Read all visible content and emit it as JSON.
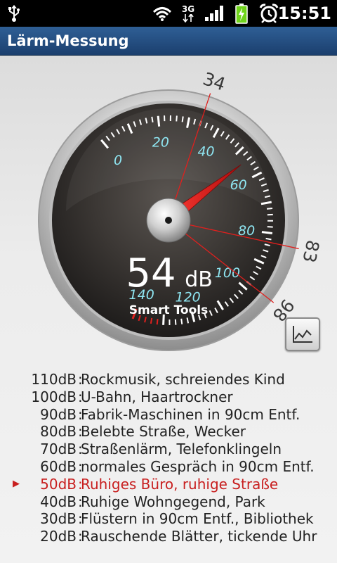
{
  "status_bar": {
    "time": "15:51",
    "network": "3G",
    "icons": [
      "usb-icon",
      "wifi-icon",
      "network-3g-icon",
      "signal-icon",
      "battery-charging-icon",
      "alarm-icon"
    ]
  },
  "app": {
    "title": "Lärm-Messung"
  },
  "gauge": {
    "reading_value": "54",
    "reading_unit": "dB",
    "brand": "Smart Tools",
    "scale_labels": [
      "0",
      "20",
      "40",
      "60",
      "80",
      "100",
      "120",
      "140"
    ],
    "min_marker": "34",
    "max_marker": "98",
    "peak_marker": "83",
    "needle_value": 54,
    "accent_color": "#e0201e",
    "scale_color": "#8fe6f2"
  },
  "chart_button": {
    "icon": "line-chart-icon"
  },
  "legend": [
    {
      "db": "110dB",
      "desc": "Rockmusik, schreiendes Kind",
      "active": false
    },
    {
      "db": "100dB",
      "desc": "U-Bahn, Haartrockner",
      "active": false
    },
    {
      "db": "90dB",
      "desc": "Fabrik-Maschinen in 90cm Entf.",
      "active": false
    },
    {
      "db": "80dB",
      "desc": "Belebte Straße, Wecker",
      "active": false
    },
    {
      "db": "70dB",
      "desc": "Straßenlärm, Telefonklingeln",
      "active": false
    },
    {
      "db": "60dB",
      "desc": "normales Gespräch in 90cm Entf.",
      "active": false
    },
    {
      "db": "50dB",
      "desc": "Ruhiges Büro, ruhige Straße",
      "active": true
    },
    {
      "db": "40dB",
      "desc": "Ruhige Wohngegend, Park",
      "active": false
    },
    {
      "db": "30dB",
      "desc": "Flüstern in 90cm Entf., Bibliothek",
      "active": false
    },
    {
      "db": "20dB",
      "desc": "Rauschende Blätter, tickende Uhr",
      "active": false
    }
  ],
  "legend_marker": "▶",
  "legend_separator": ":"
}
